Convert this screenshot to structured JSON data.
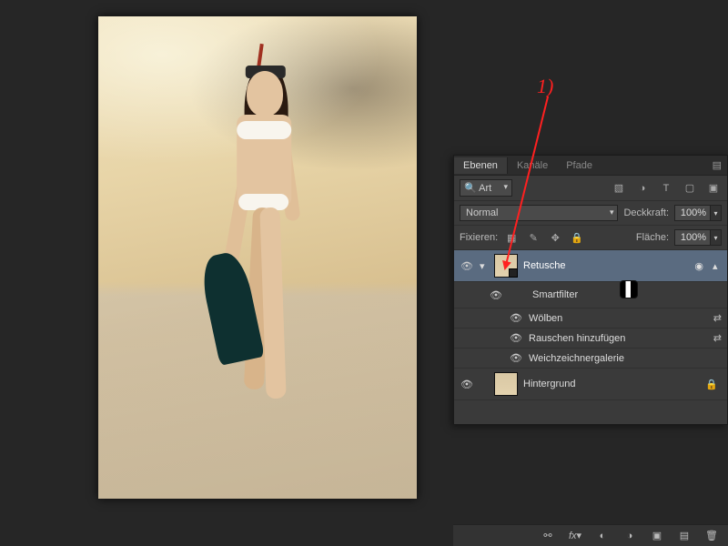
{
  "annotation": {
    "label": "1)"
  },
  "panel": {
    "tabs": {
      "layers": "Ebenen",
      "channels": "Kanäle",
      "paths": "Pfade"
    },
    "search": {
      "label": "Art"
    },
    "blend_mode": "Normal",
    "opacity_label": "Deckkraft:",
    "opacity_value": "100%",
    "lock_label": "Fixieren:",
    "fill_label": "Fläche:",
    "fill_value": "100%",
    "layers": {
      "retusche": "Retusche",
      "smartfilter": "Smartfilter",
      "filters": {
        "wolben": "Wölben",
        "rauschen": "Rauschen hinzufügen",
        "weichzeichner": "Weichzeichnergalerie"
      },
      "hintergrund": "Hintergrund"
    }
  }
}
